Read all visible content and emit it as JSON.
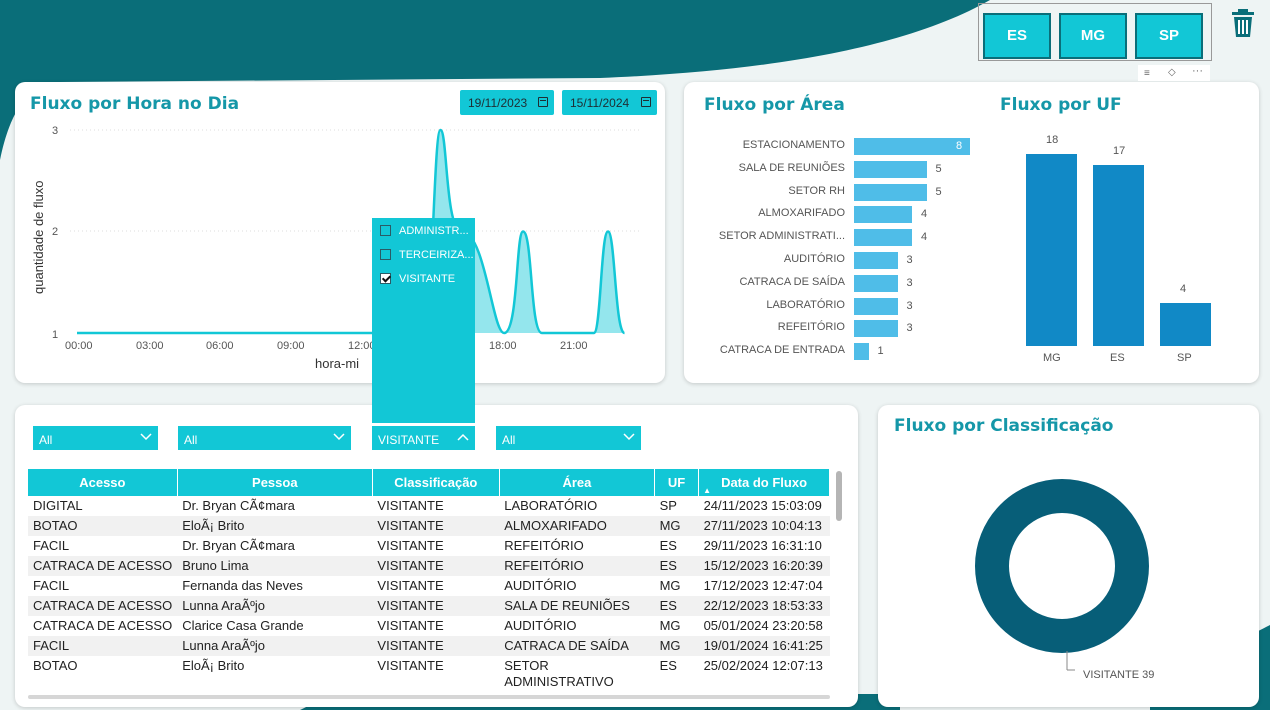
{
  "colors": {
    "teal_dark": "#0a6e79",
    "accent": "#12c7d6",
    "bar_light": "#4fbde8",
    "bar_dark": "#1189c6",
    "donut": "#075e78"
  },
  "uf_slicer": {
    "buttons": [
      "ES",
      "MG",
      "SP"
    ]
  },
  "fluxo_hora": {
    "title": "Fluxo por Hora no Dia",
    "date_start": "19/11/2023",
    "date_end": "15/11/2024",
    "ylabel": "quantidade de fluxo",
    "xlabel": "hora-mi",
    "yticks": [
      "1",
      "2",
      "3"
    ],
    "xticks": [
      "00:00",
      "03:00",
      "06:00",
      "09:00",
      "12:00",
      "18:00",
      "21:00"
    ]
  },
  "popup": {
    "items": [
      {
        "label": "ADMINISTR...",
        "checked": false
      },
      {
        "label": "TERCEIRIZA...",
        "checked": false
      },
      {
        "label": "VISITANTE",
        "checked": true
      }
    ]
  },
  "fluxo_area": {
    "title": "Fluxo por Área"
  },
  "fluxo_uf": {
    "title": "Fluxo por UF"
  },
  "fluxo_class": {
    "title": "Fluxo por Classificação",
    "legend": "VISITANTE 39"
  },
  "filters": {
    "f1": "All",
    "f2": "All",
    "f3": "VISITANTE",
    "f4": "All"
  },
  "table": {
    "headers": [
      "Acesso",
      "Pessoa",
      "Classificação",
      "Área",
      "UF",
      "Data do Fluxo"
    ],
    "rows": [
      [
        "DIGITAL",
        "Dr. Bryan CÃ¢mara",
        "VISITANTE",
        "LABORATÓRIO",
        "SP",
        "24/11/2023 15:03:09"
      ],
      [
        "BOTAO",
        "EloÃ¡ Brito",
        "VISITANTE",
        "ALMOXARIFADO",
        "MG",
        "27/11/2023 10:04:13"
      ],
      [
        "FACIL",
        "Dr. Bryan CÃ¢mara",
        "VISITANTE",
        "REFEITÓRIO",
        "ES",
        "29/11/2023 16:31:10"
      ],
      [
        "CATRACA DE ACESSO",
        "Bruno Lima",
        "VISITANTE",
        "REFEITÓRIO",
        "ES",
        "15/12/2023 16:20:39"
      ],
      [
        "FACIL",
        "Fernanda das Neves",
        "VISITANTE",
        "AUDITÓRIO",
        "MG",
        "17/12/2023 12:47:04"
      ],
      [
        "CATRACA DE ACESSO",
        "Lunna AraÃºjo",
        "VISITANTE",
        "SALA DE REUNIÕES",
        "ES",
        "22/12/2023 18:53:33"
      ],
      [
        "CATRACA DE ACESSO",
        "Clarice Casa Grande",
        "VISITANTE",
        "AUDITÓRIO",
        "MG",
        "05/01/2024 23:20:58"
      ],
      [
        "FACIL",
        "Lunna AraÃºjo",
        "VISITANTE",
        "CATRACA DE SAÍDA",
        "MG",
        "19/01/2024 16:41:25"
      ],
      [
        "BOTAO",
        "EloÃ¡ Brito",
        "VISITANTE",
        "SETOR ADMINISTRATIVO",
        "ES",
        "25/02/2024 12:07:13"
      ]
    ]
  },
  "chart_data": [
    {
      "type": "area",
      "title": "Fluxo por Hora no Dia",
      "xlabel": "hora-mi",
      "ylabel": "quantidade de fluxo",
      "ylim": [
        1,
        3
      ],
      "x": [
        "00:00",
        "03:00",
        "06:00",
        "09:00",
        "12:00",
        "15:00",
        "16:00",
        "18:00",
        "21:00",
        "22:00"
      ],
      "values": [
        1,
        1,
        1,
        1,
        1,
        3,
        2,
        2,
        2,
        1
      ]
    },
    {
      "type": "bar",
      "title": "Fluxo por Área",
      "orientation": "horizontal",
      "categories": [
        "ESTACIONAMENTO",
        "SALA DE REUNIÕES",
        "SETOR RH",
        "ALMOXARIFADO",
        "SETOR ADMINISTRATI...",
        "AUDITÓRIO",
        "CATRACA DE SAÍDA",
        "LABORATÓRIO",
        "REFEITÓRIO",
        "CATRACA DE ENTRADA"
      ],
      "values": [
        8,
        5,
        5,
        4,
        4,
        3,
        3,
        3,
        3,
        1
      ]
    },
    {
      "type": "bar",
      "title": "Fluxo por UF",
      "categories": [
        "MG",
        "ES",
        "SP"
      ],
      "values": [
        18,
        17,
        4
      ]
    },
    {
      "type": "pie",
      "title": "Fluxo por Classificação",
      "categories": [
        "VISITANTE"
      ],
      "values": [
        39
      ]
    }
  ]
}
